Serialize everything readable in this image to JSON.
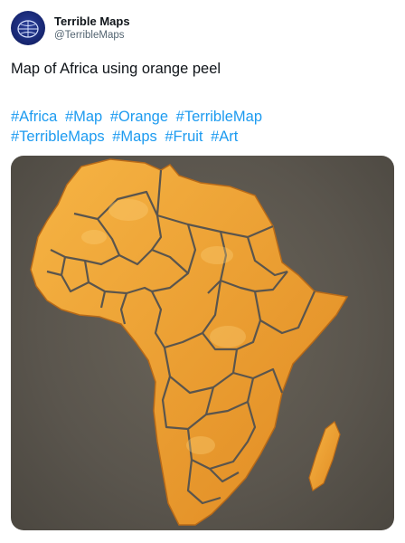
{
  "account": {
    "display_name": "Terrible Maps",
    "handle": "@TerribleMaps",
    "avatar_icon": "globe-icon"
  },
  "tweet": {
    "text": "Map of Africa using orange peel",
    "hashtags": [
      "#Africa",
      "#Map",
      "#Orange",
      "#TerribleMap",
      "#TerribleMaps",
      "#Maps",
      "#Fruit",
      "#Art"
    ]
  },
  "colors": {
    "link": "#1d9bf0",
    "peel": "#f0a032",
    "background": "#5a554d"
  }
}
